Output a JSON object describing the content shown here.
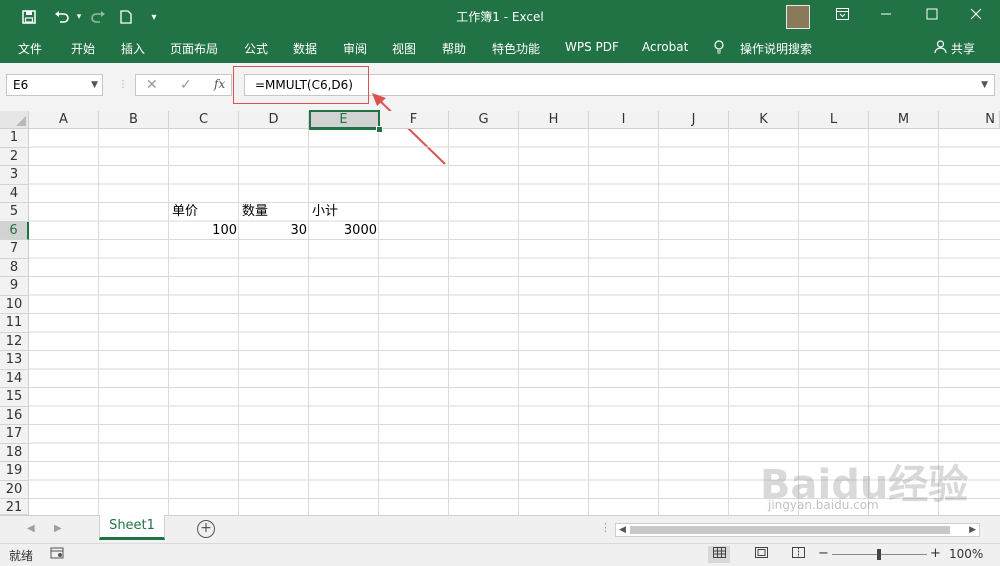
{
  "app": {
    "title": "工作簿1  -  Excel"
  },
  "qat": {
    "save_icon": "save-icon",
    "undo_icon": "undo-icon",
    "redo_icon": "redo-icon",
    "new_icon": "new-document-icon",
    "customize_icon": "customize-qat-icon"
  },
  "ribbon": {
    "tabs": [
      "文件",
      "开始",
      "插入",
      "页面布局",
      "公式",
      "数据",
      "审阅",
      "视图",
      "帮助",
      "特色功能",
      "WPS PDF",
      "Acrobat"
    ],
    "tell_me": "操作说明搜索",
    "share": "共享"
  },
  "formula_bar": {
    "name_box": "E6",
    "cancel": "✕",
    "enter": "✓",
    "fx": "fx",
    "formula": "=MMULT(C6,D6)"
  },
  "sheet": {
    "columns": [
      "A",
      "B",
      "C",
      "D",
      "E",
      "F",
      "G",
      "H",
      "I",
      "J",
      "K",
      "L",
      "M",
      "N"
    ],
    "selected_column": "E",
    "rows": [
      "1",
      "2",
      "3",
      "4",
      "5",
      "6",
      "7",
      "8",
      "9",
      "10",
      "11",
      "12",
      "13",
      "14",
      "15",
      "16",
      "17",
      "18",
      "19",
      "20",
      "21"
    ],
    "selected_row": "6",
    "cells": {
      "C5": "单价",
      "D5": "数量",
      "E5": "小计",
      "C6": "100",
      "D6": "30",
      "E6": "3000"
    }
  },
  "tabs_bar": {
    "sheet_name": "Sheet1",
    "add_sheet": "+"
  },
  "status_bar": {
    "status": "就绪",
    "zoom": "100%",
    "zoom_fraction": 0.5,
    "zoom_out": "−",
    "zoom_in": "+"
  },
  "watermark": {
    "text": "Baidu经验",
    "url": "jingyan.baidu.com"
  },
  "colors": {
    "accent": "#217346",
    "annotation": "#d9534f"
  }
}
